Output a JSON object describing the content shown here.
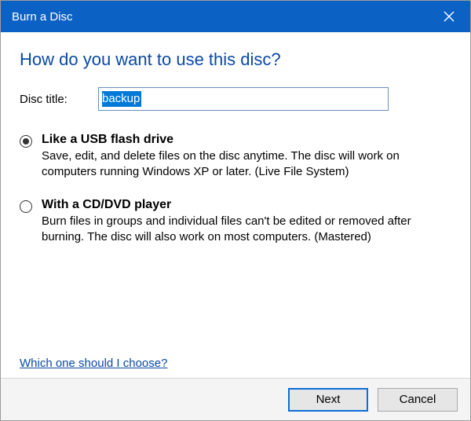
{
  "titlebar": {
    "title": "Burn a Disc",
    "close_icon_name": "close-icon"
  },
  "heading": "How do you want to use this disc?",
  "disc_title_field": {
    "label": "Disc title:",
    "value": "backup"
  },
  "options": [
    {
      "id": "usb",
      "title": "Like a USB flash drive",
      "desc": "Save, edit, and delete files on the disc anytime. The disc will work on computers running Windows XP or later. (Live File System)",
      "selected": true
    },
    {
      "id": "cddvd",
      "title": "With a CD/DVD player",
      "desc": "Burn files in groups and individual files can't be edited or removed after burning. The disc will also work on most computers. (Mastered)",
      "selected": false
    }
  ],
  "help_link": "Which one should I choose?",
  "buttons": {
    "next": "Next",
    "cancel": "Cancel"
  }
}
